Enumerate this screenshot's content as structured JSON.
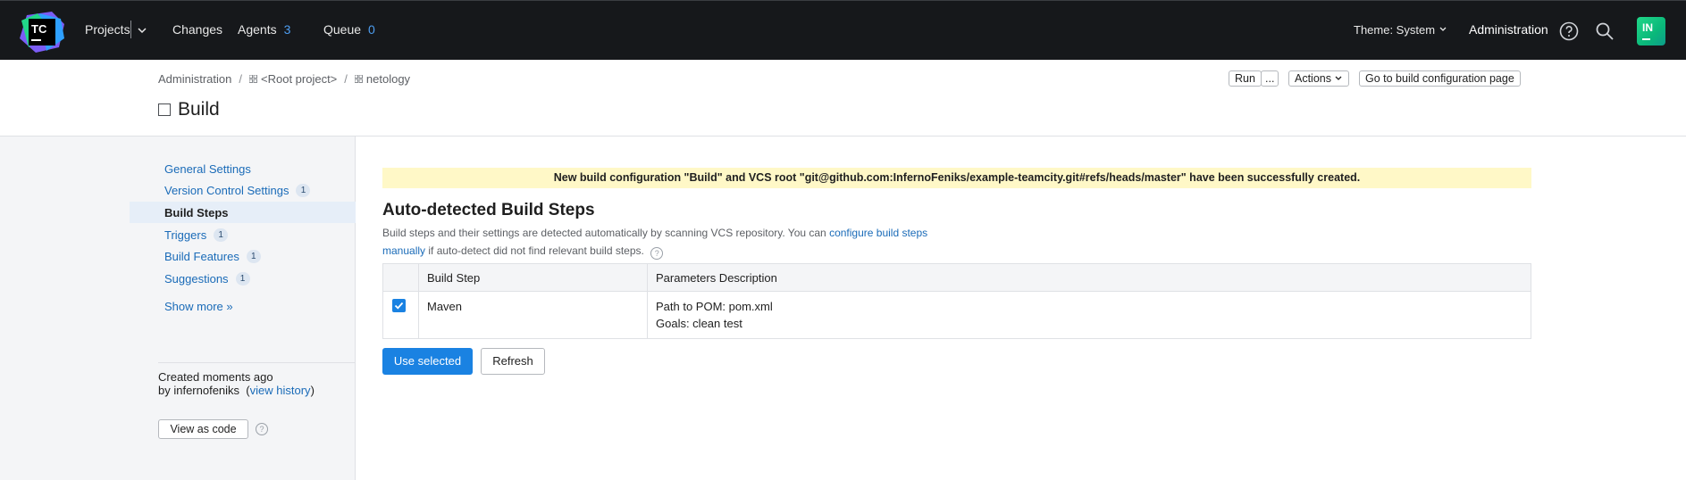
{
  "topbar": {
    "logo_text": "TC",
    "projects_label": "Projects",
    "changes_label": "Changes",
    "agents_label": "Agents",
    "agents_count": "3",
    "queue_label": "Queue",
    "queue_count": "0",
    "theme_label": "Theme: System",
    "admin_label": "Administration",
    "avatar_initials": "IN",
    "icons": [
      "help-icon",
      "search-icon"
    ]
  },
  "breadcrumb": {
    "items": [
      "Administration",
      "<Root project>",
      "netology"
    ],
    "separator": "/"
  },
  "page": {
    "title": "Build"
  },
  "header_actions": {
    "run": "Run",
    "run_more": "...",
    "actions": "Actions",
    "goto": "Go to build configuration page"
  },
  "sidebar": {
    "items": [
      {
        "label": "General Settings",
        "badge": ""
      },
      {
        "label": "Version Control Settings",
        "badge": "1"
      },
      {
        "label": "Build Steps",
        "badge": ""
      },
      {
        "label": "Triggers",
        "badge": "1"
      },
      {
        "label": "Build Features",
        "badge": "1"
      },
      {
        "label": "Suggestions",
        "badge": "1"
      }
    ],
    "active": "Build Steps",
    "show_more": "Show more »",
    "created_line1": "Created moments ago",
    "created_by": "by infernofeniks",
    "view_history_open": "(",
    "view_history": "view history",
    "view_history_close": ")",
    "view_as_code": "View as code",
    "help_glyph": "?"
  },
  "main": {
    "notice": "New build configuration \"Build\" and VCS root \"git@github.com:InfernoFeniks/example-teamcity.git#refs/heads/master\" have been successfully created.",
    "section_title": "Auto-detected Build Steps",
    "desc_part1": "Build steps and their settings are detected automatically by scanning VCS repository. You can ",
    "desc_link1": "configure build steps",
    "desc_link2": "manually",
    "desc_part2": " if auto-detect did not find relevant build steps.",
    "table": {
      "headers": [
        "",
        "Build Step",
        "Parameters Description"
      ],
      "rows": [
        {
          "checked": true,
          "step": "Maven",
          "param1": "Path to POM: pom.xml",
          "param2": "Goals: clean test"
        }
      ]
    },
    "use_selected": "Use selected",
    "refresh": "Refresh"
  },
  "colors": {
    "topbar_bg": "#16181b",
    "accent": "#1a82e2",
    "link": "#1a6bb8",
    "notice_bg": "#fff8c7",
    "sidebar_bg": "#f4f5f7"
  }
}
